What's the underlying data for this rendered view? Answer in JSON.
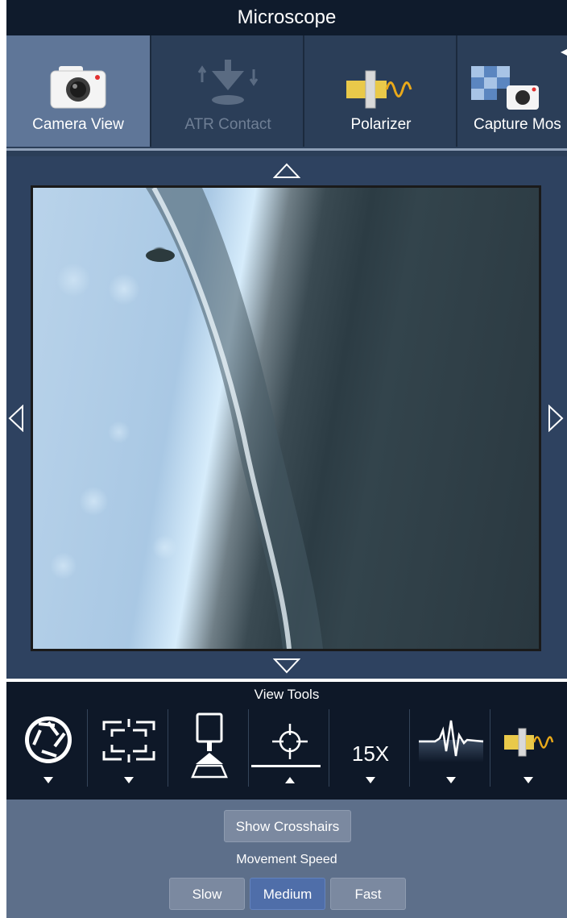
{
  "window": {
    "title": "Microscope"
  },
  "toolbar": {
    "items": [
      {
        "label": "Camera View",
        "icon": "camera-icon",
        "state": "active"
      },
      {
        "label": "ATR Contact",
        "icon": "atr-contact-icon",
        "state": "disabled"
      },
      {
        "label": "Polarizer",
        "icon": "polarizer-icon",
        "state": "normal"
      },
      {
        "label": "Capture Mos",
        "icon": "capture-mosaic-icon",
        "state": "normal"
      }
    ]
  },
  "camera": {
    "nav": {
      "up": "up-arrow-icon",
      "down": "down-arrow-icon",
      "left": "left-arrow-icon",
      "right": "right-arrow-icon"
    }
  },
  "view_tools": {
    "title": "View Tools",
    "tools": [
      {
        "icon": "aperture-icon",
        "caret": "down"
      },
      {
        "icon": "frame-crop-icon",
        "caret": "down"
      },
      {
        "icon": "illumination-icon",
        "caret": "none"
      },
      {
        "icon": "crosshair-icon",
        "caret": "up",
        "selected": true
      },
      {
        "text": "15X",
        "caret": "down"
      },
      {
        "icon": "spectrum-icon",
        "caret": "down"
      },
      {
        "icon": "polarizer-icon",
        "caret": "down"
      }
    ]
  },
  "options": {
    "crosshairs_button": "Show Crosshairs",
    "speed_label": "Movement Speed",
    "speeds": [
      "Slow",
      "Medium",
      "Fast"
    ],
    "selected_speed": "Medium"
  },
  "colors": {
    "titlebar": "#0f1b2c",
    "toolbar": "#2b3e58",
    "active_tool": "#5f7698",
    "panel": "#2e4260",
    "viewtools": "#0e1828",
    "options": "#5d6f8a",
    "selected_button": "#4f6ea9"
  }
}
